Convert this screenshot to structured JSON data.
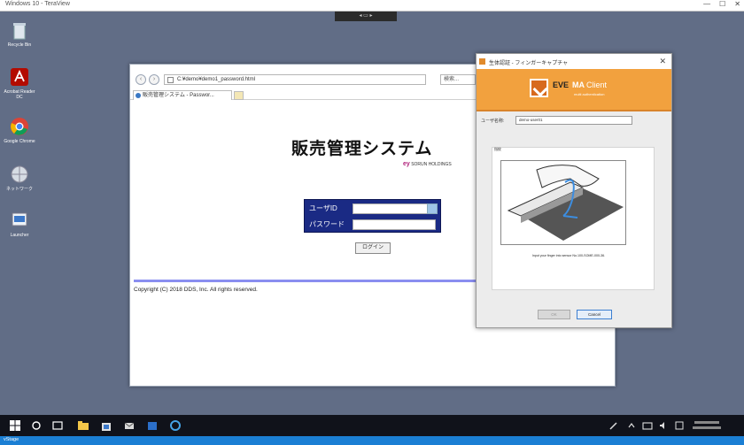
{
  "outer_window": {
    "title": "Windows 10 - TeraView",
    "controls": [
      "—",
      "☐",
      "✕"
    ]
  },
  "remote_toolbar": "◂ ▭ ▸",
  "desktop_icons": [
    {
      "name": "recycle-bin-icon",
      "label": "Recycle Bin"
    },
    {
      "name": "acrobat-icon",
      "label": "Acrobat Reader DC"
    },
    {
      "name": "chrome-icon",
      "label": "Google Chrome"
    },
    {
      "name": "network-icon",
      "label": "ネットワーク"
    },
    {
      "name": "app-icon",
      "label": "Launcher"
    }
  ],
  "browser": {
    "address": "C:¥demo¥demo1_password.html",
    "search_placeholder": "検索...",
    "tab_label": "販売管理システム - Passwor...",
    "app_title": "販売管理システム",
    "company_mark": "ey",
    "company_name": "SORUN HOLDINGS",
    "login": {
      "user_id_label": "ユーザID",
      "password_label": "パスワード",
      "button_label": "ログイン"
    },
    "copyright": "Copyright (C) 2018 DDS, Inc. All rights reserved."
  },
  "dialog": {
    "title": "生体認証 - フィンガーキャプチャ",
    "logo_eve": "EVE",
    "logo_ma": "MA",
    "logo_client": "Client",
    "logo_sub": "multi authentication",
    "user_label": "ユーザ名称:",
    "user_value": "demo-user01",
    "auth_tab": "指紋",
    "instruction": "Input your finger into sensor No.100-SOME-000-36.",
    "ok_label": "OK",
    "cancel_label": "Cancel"
  },
  "status_bar": {
    "text": "vStage"
  },
  "colors": {
    "desktop": "#616d86",
    "login_panel": "#1a2a84",
    "banner": "#f2a13e",
    "taskbar": "#10121a"
  }
}
